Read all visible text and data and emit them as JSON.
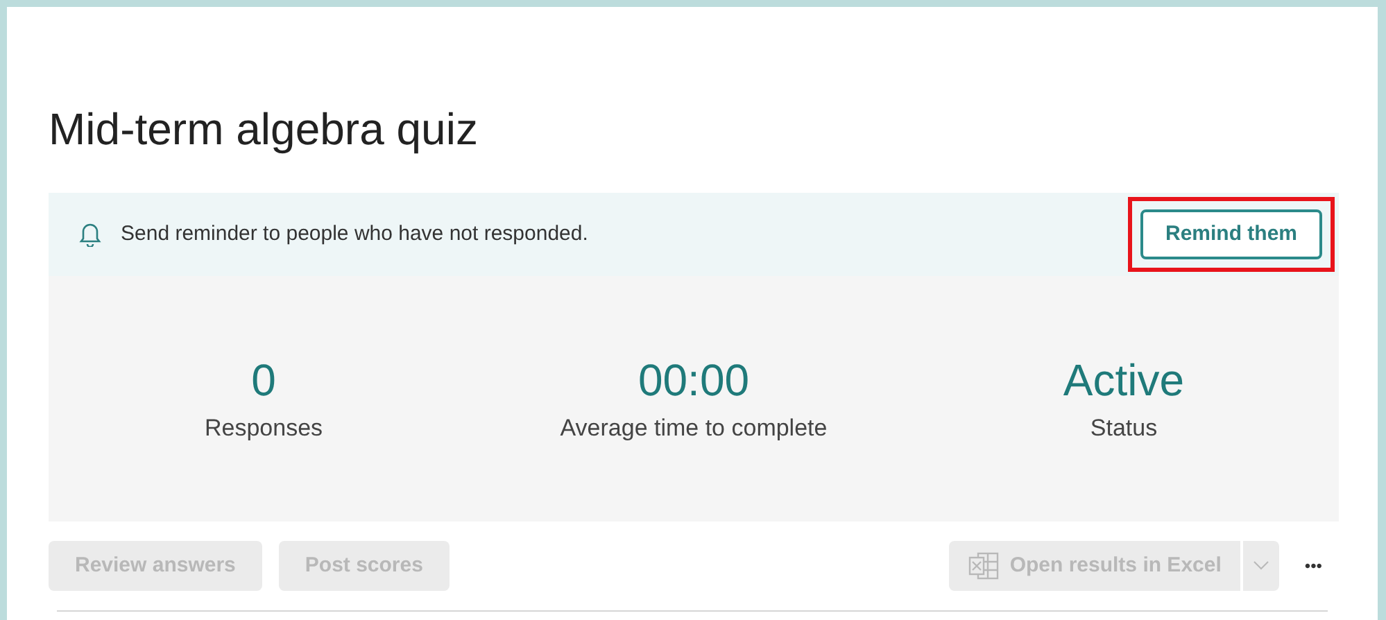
{
  "title": "Mid-term algebra quiz",
  "reminder": {
    "text": "Send reminder to people who have not responded.",
    "button": "Remind them",
    "highlighted": true
  },
  "stats": [
    {
      "value": "0",
      "label": "Responses"
    },
    {
      "value": "00:00",
      "label": "Average time to complete"
    },
    {
      "value": "Active",
      "label": "Status"
    }
  ],
  "actions": [
    {
      "label": "Review answers",
      "disabled": true
    },
    {
      "label": "Post scores",
      "disabled": true
    }
  ],
  "excel_button": {
    "label": "Open results in Excel",
    "disabled": true
  },
  "more_button": "•••"
}
